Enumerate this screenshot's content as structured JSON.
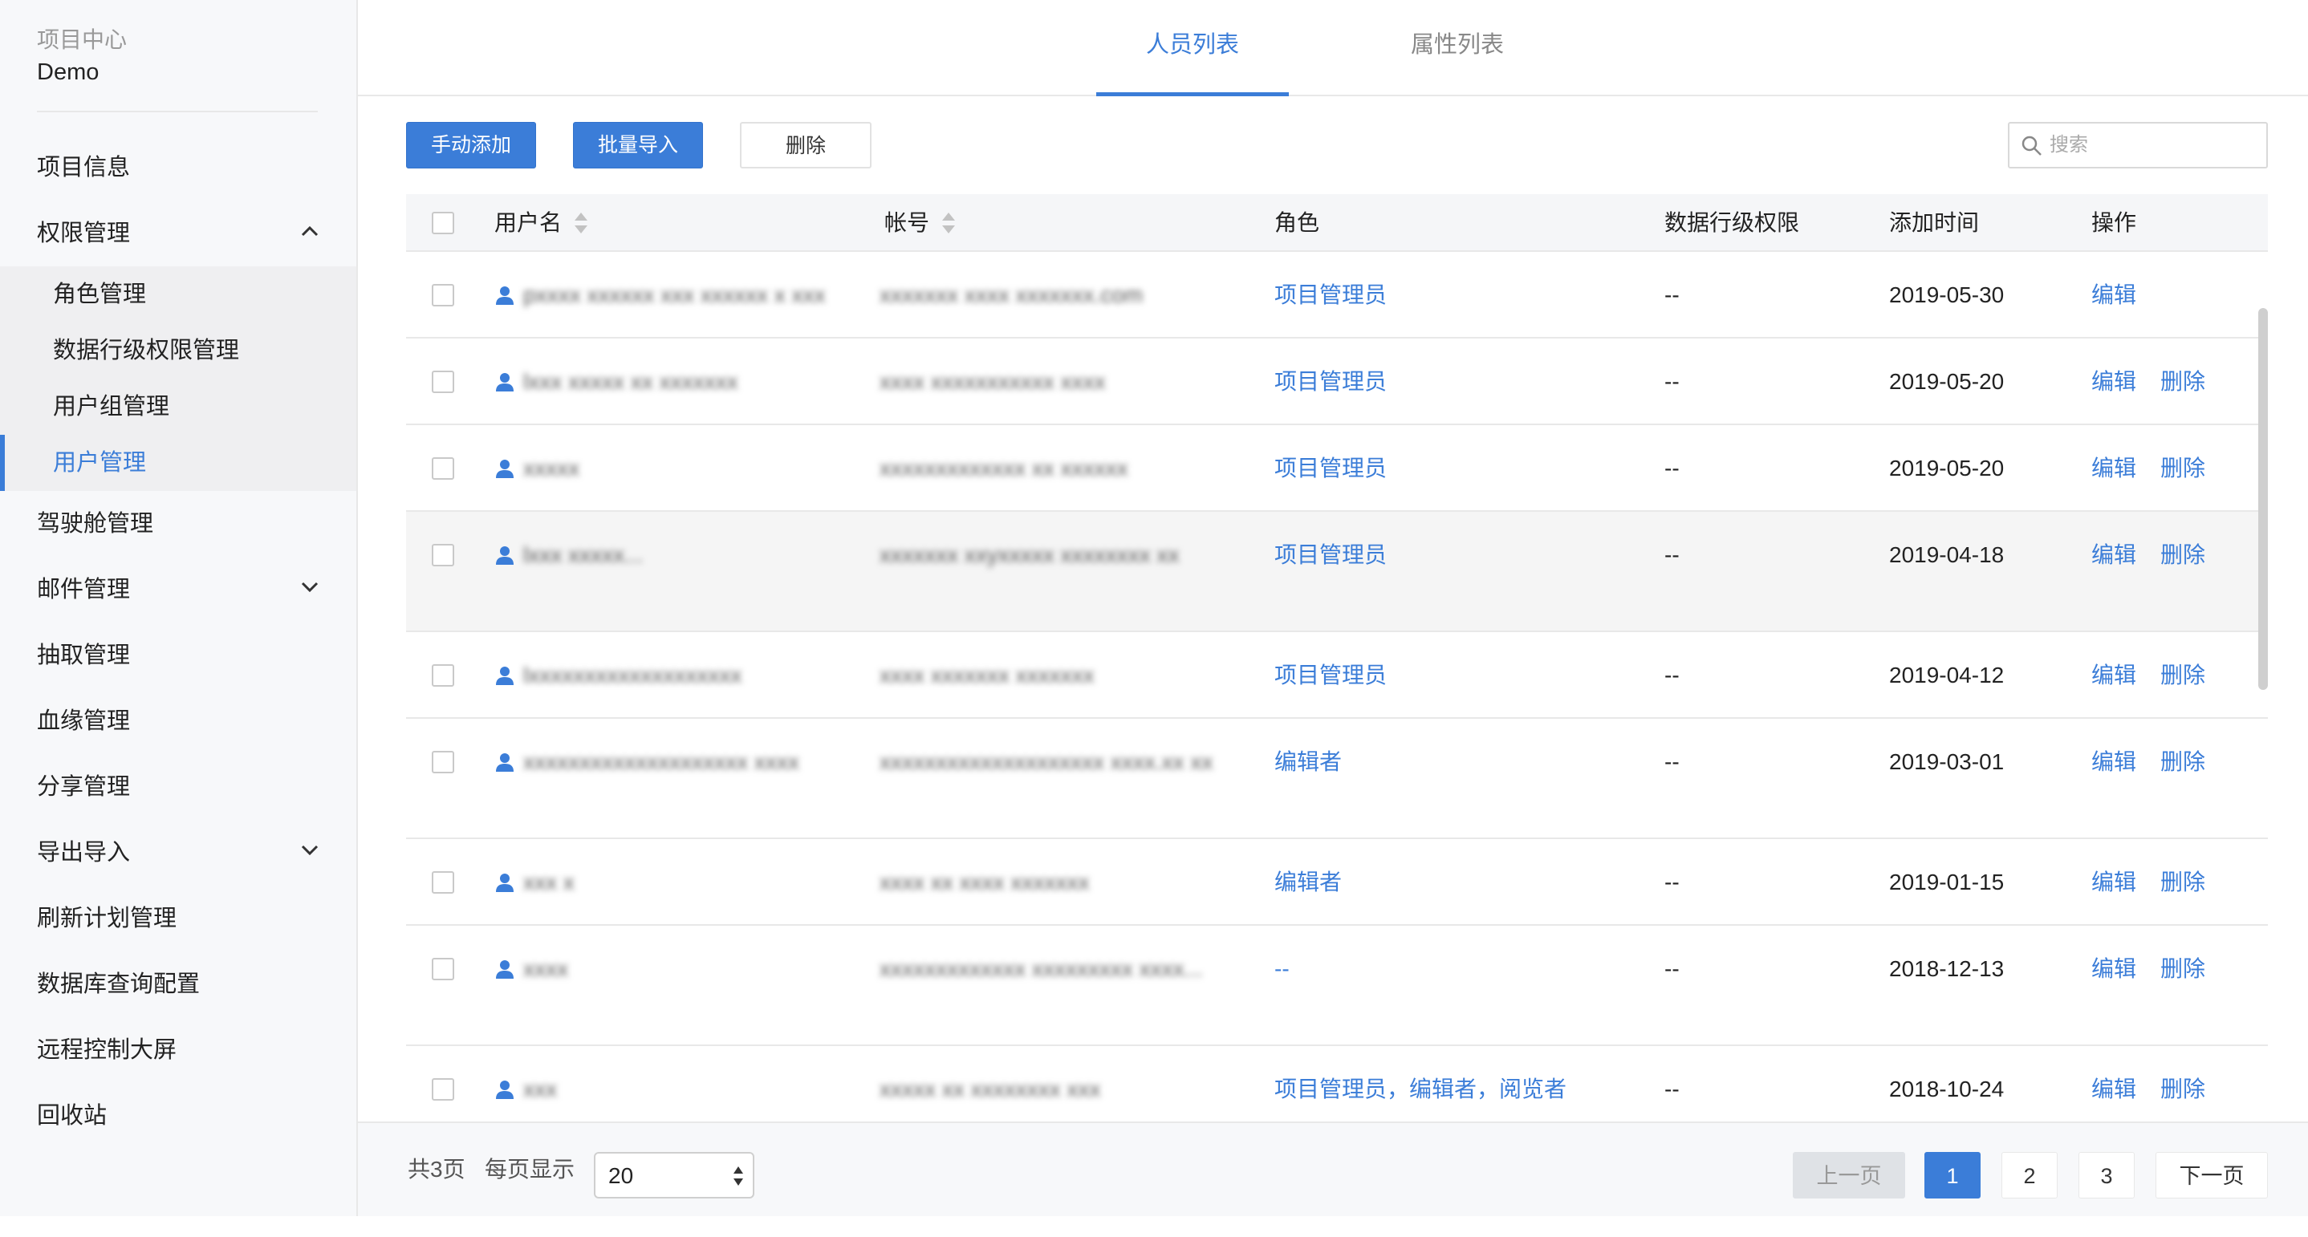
{
  "sidebar": {
    "project_label": "项目中心",
    "project_name": "Demo",
    "items": [
      {
        "label": "项目信息"
      },
      {
        "label": "权限管理",
        "expanded": true,
        "chevron": "chevron-up-icon"
      },
      {
        "label": "驾驶舱管理"
      },
      {
        "label": "邮件管理",
        "chevron": "chevron-down-icon"
      },
      {
        "label": "抽取管理"
      },
      {
        "label": "血缘管理"
      },
      {
        "label": "分享管理"
      },
      {
        "label": "导出导入",
        "chevron": "chevron-down-icon"
      },
      {
        "label": "刷新计划管理"
      },
      {
        "label": "数据库查询配置"
      },
      {
        "label": "远程控制大屏"
      },
      {
        "label": "回收站"
      }
    ],
    "sub_items": [
      {
        "label": "角色管理"
      },
      {
        "label": "数据行级权限管理"
      },
      {
        "label": "用户组管理"
      },
      {
        "label": "用户管理",
        "active": true
      }
    ]
  },
  "tabs": [
    {
      "label": "人员列表",
      "active": true
    },
    {
      "label": "属性列表"
    }
  ],
  "toolbar": {
    "add_label": "手动添加",
    "import_label": "批量导入",
    "delete_label": "删除"
  },
  "search": {
    "placeholder": "搜索",
    "icon": "search-icon"
  },
  "table": {
    "columns": {
      "username": "用户名",
      "account": "帐号",
      "role": "角色",
      "row_permission": "数据行级权限",
      "added_time": "添加时间",
      "actions": "操作"
    },
    "edit_label": "编辑",
    "delete_label": "删除",
    "rows": [
      {
        "username": "pxxxx xxxxxx xxx xxxxxx x xxx",
        "account": "xxxxxxx xxxx xxxxxxx.com",
        "role": "项目管理员",
        "row_permission": "--",
        "added_time": "2019-05-30",
        "deletable": false
      },
      {
        "username": "lxxx xxxxx xx xxxxxxx",
        "account": "xxxx xxxxxxxxxxx xxxx",
        "role": "项目管理员",
        "row_permission": "--",
        "added_time": "2019-05-20",
        "deletable": true
      },
      {
        "username": "xxxxx",
        "account": "xxxxxxxxxxxxx xx xxxxxx",
        "role": "项目管理员",
        "row_permission": "--",
        "added_time": "2019-05-20",
        "deletable": true
      },
      {
        "username": "lxxx xxxxx...",
        "account": "xxxxxxx xxyxxxxx xxxxxxxx xx",
        "role": "项目管理员",
        "row_permission": "--",
        "added_time": "2019-04-18",
        "deletable": true
      },
      {
        "username": "lxxxxxxxxxxxxxxxxxxx",
        "account": "xxxx xxxxxxx xxxxxxx",
        "role": "项目管理员",
        "row_permission": "--",
        "added_time": "2019-04-12",
        "deletable": true
      },
      {
        "username": "xxxxxxxxxxxxxxxxxxxx xxxx",
        "account": "xxxxxxxxxxxxxxxxxxxx xxxx.xx xx",
        "role": "编辑者",
        "row_permission": "--",
        "added_time": "2019-03-01",
        "deletable": true
      },
      {
        "username": "xxx x",
        "account": "xxxx xx xxxx xxxxxxx",
        "role": "编辑者",
        "row_permission": "--",
        "added_time": "2019-01-15",
        "deletable": true
      },
      {
        "username": "xxxx",
        "account": "xxxxxxxxxxxxx xxxxxxxxx xxxx...",
        "role": "--",
        "row_permission": "--",
        "added_time": "2018-12-13",
        "deletable": true
      },
      {
        "username": "xxx",
        "account": "xxxxx xx xxxxxxxx xxx",
        "role": "项目管理员，编辑者，阅览者",
        "row_permission": "--",
        "added_time": "2018-10-24",
        "deletable": true
      }
    ]
  },
  "footer": {
    "total_pages": "共3页",
    "per_page_label": "每页显示",
    "per_page_value": "20",
    "prev_label": "上一页",
    "next_label": "下一页",
    "pages": [
      "1",
      "2",
      "3"
    ],
    "current_page": "1"
  },
  "colors": {
    "accent": "#3b7dd8",
    "sidebar_bg": "#f7f8fa"
  }
}
